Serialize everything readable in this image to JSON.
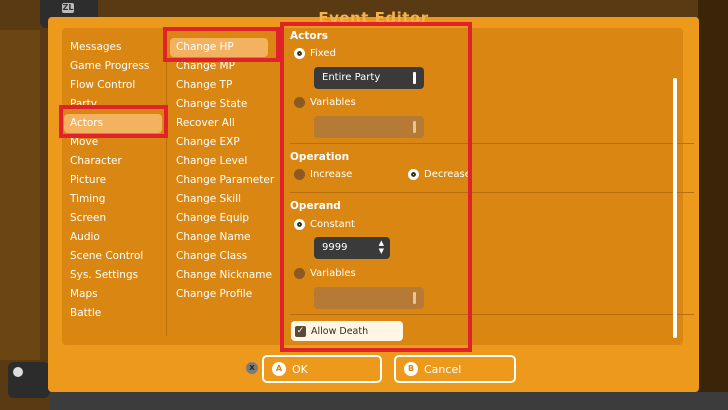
{
  "window": {
    "title": "Event Editor"
  },
  "categories": [
    "Messages",
    "Game Progress",
    "Flow Control",
    "Party",
    "Actors",
    "Move",
    "Character",
    "Picture",
    "Timing",
    "Screen",
    "Audio",
    "Scene Control",
    "Sys. Settings",
    "Maps",
    "Battle"
  ],
  "selected_category": "Actors",
  "commands": [
    "Change HP",
    "Change MP",
    "Change TP",
    "Change State",
    "Recover All",
    "Change EXP",
    "Change Level",
    "Change Parameter",
    "Change Skill",
    "Change Equip",
    "Change Name",
    "Change Class",
    "Change Nickname",
    "Change Profile"
  ],
  "selected_command": "Change HP",
  "form": {
    "actors": {
      "title": "Actors",
      "fixed_label": "Fixed",
      "fixed_value": "Entire Party",
      "variables_label": "Variables"
    },
    "operation": {
      "title": "Operation",
      "increase_label": "Increase",
      "decrease_label": "Decrease"
    },
    "operand": {
      "title": "Operand",
      "constant_label": "Constant",
      "constant_value": "9999",
      "variables_label": "Variables"
    },
    "allow_death_label": "Allow Death"
  },
  "footer": {
    "ok_key": "A",
    "ok_label": "OK",
    "cancel_key": "B",
    "cancel_label": "Cancel",
    "x_key": "X"
  },
  "colors": {
    "dialog": "#ed9a1c",
    "panel": "#d98712",
    "highlight_box": "#e0222a"
  }
}
